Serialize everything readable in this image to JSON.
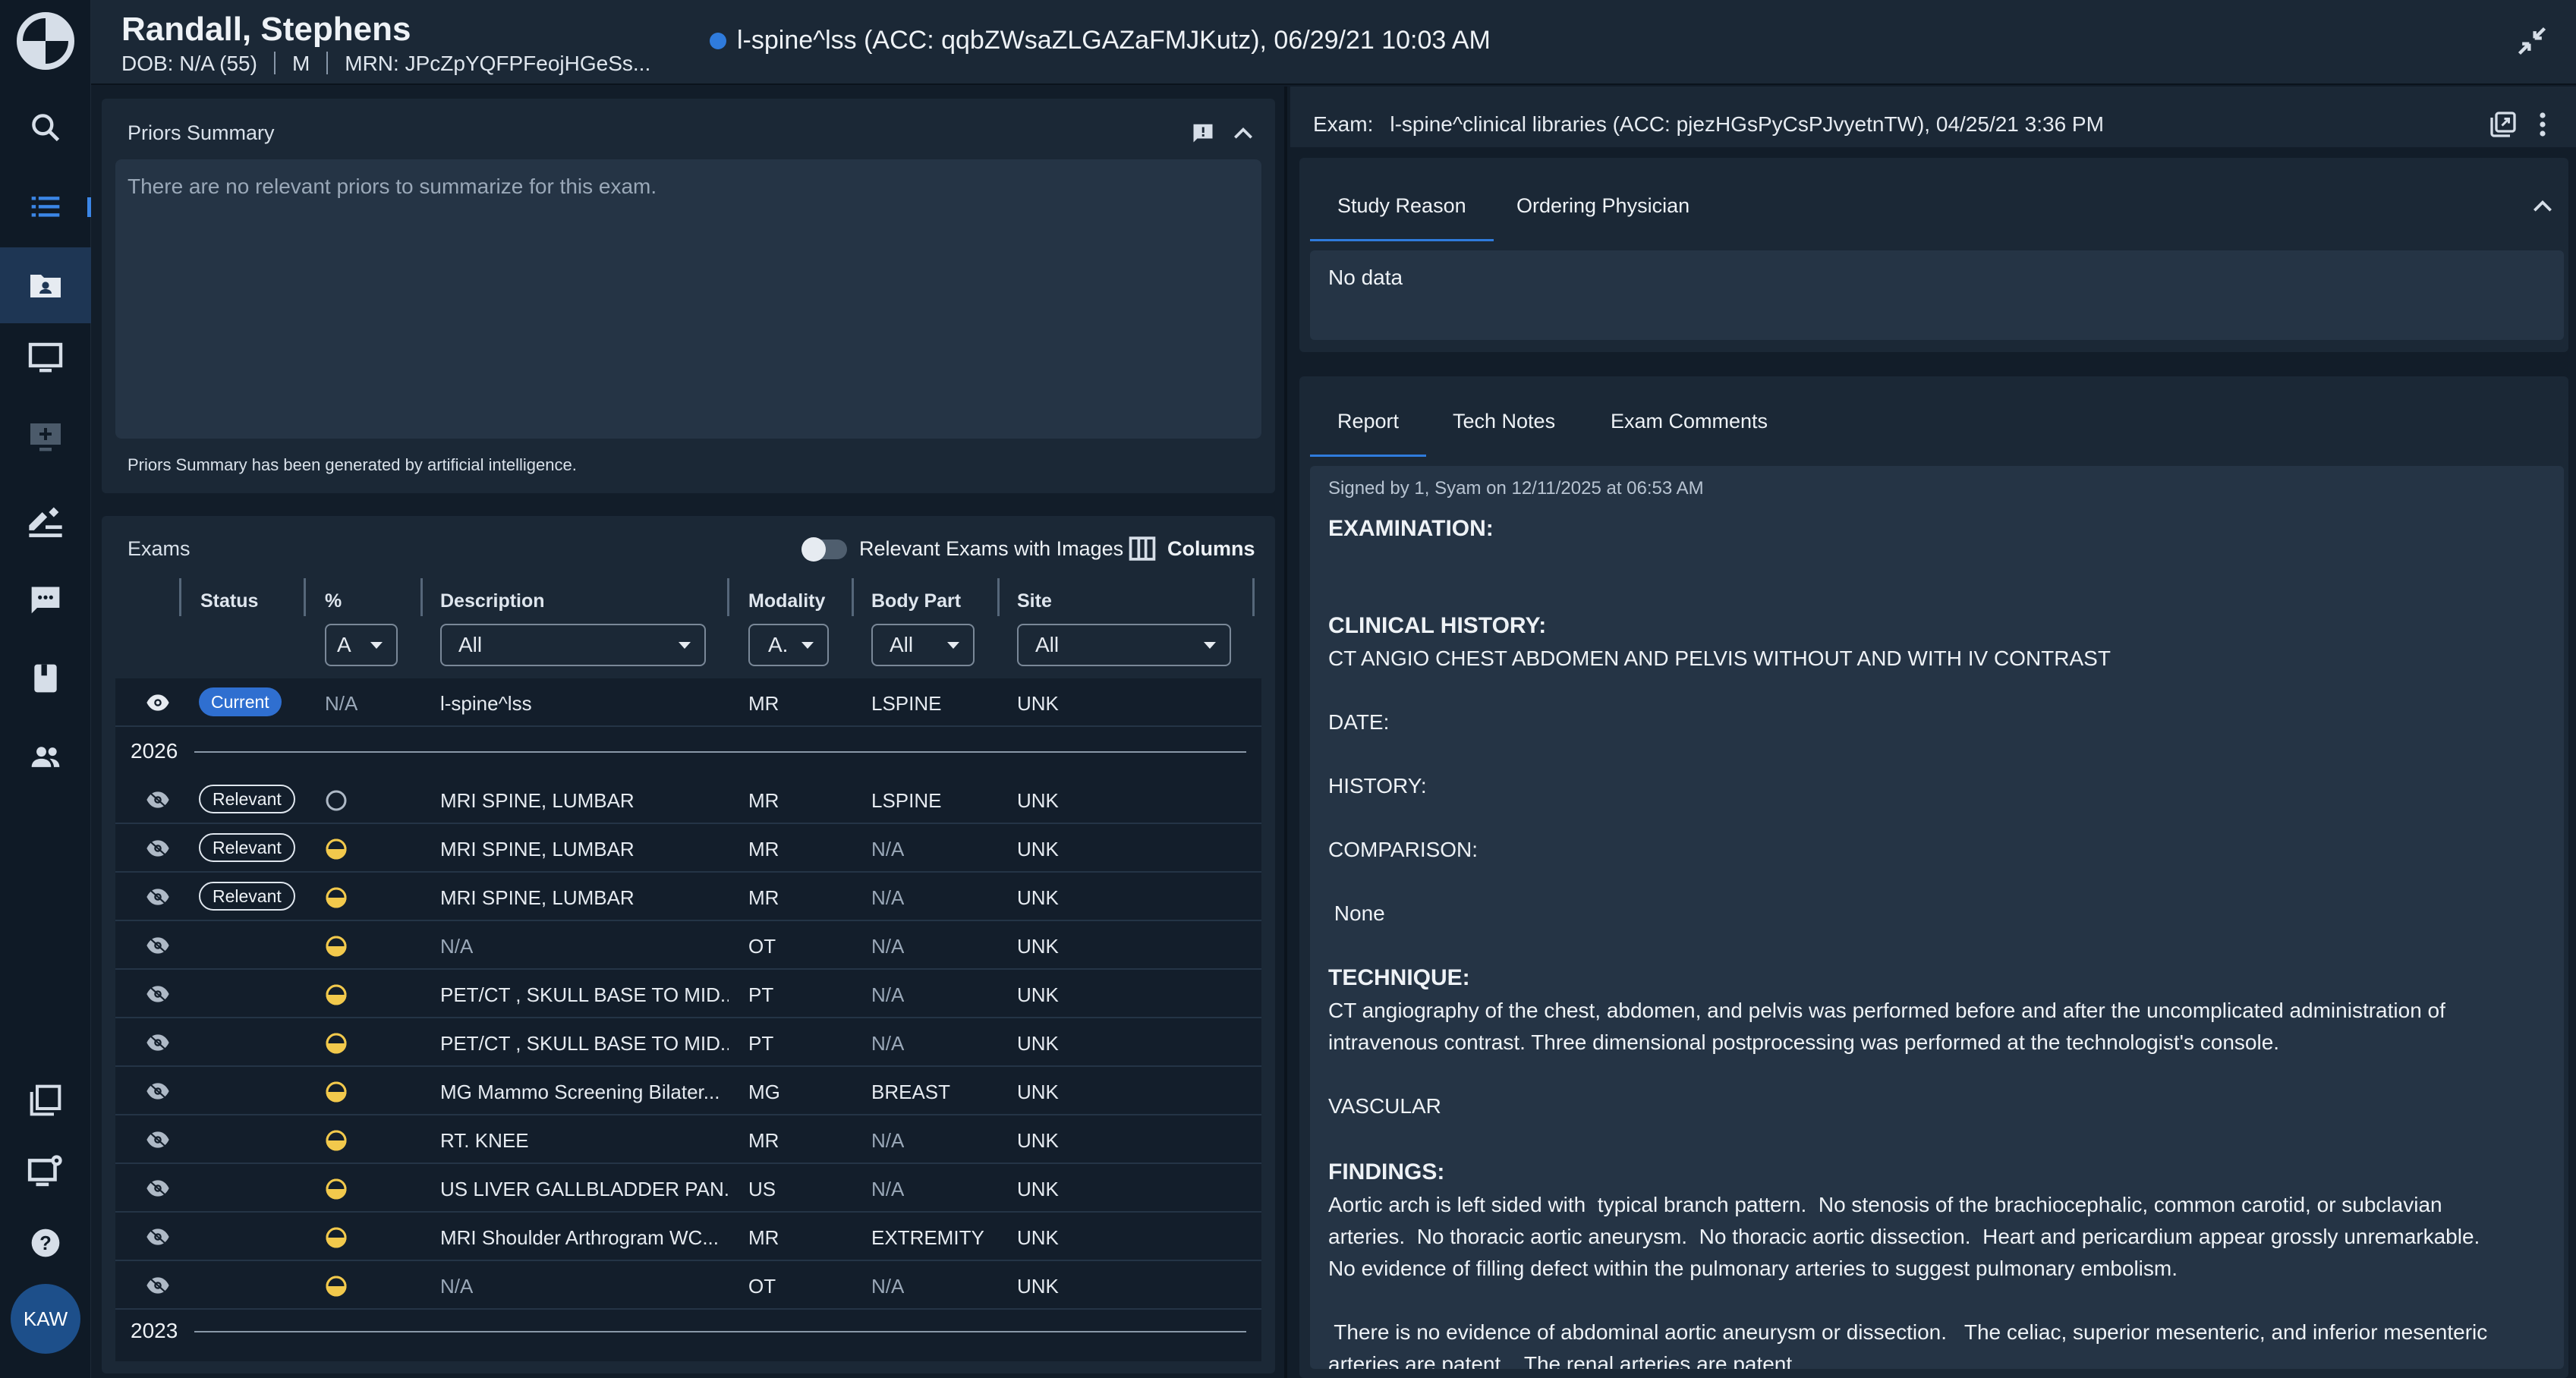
{
  "header": {
    "patient_name": "Randall, Stephens",
    "dob": "DOB: N/A (55)",
    "sex": "M",
    "mrn": "MRN: JPcZpYQFPFeojHGeSs...",
    "exam": "l-spine^lss (ACC: qqbZWsaZLGAZaFMJKutz), 06/29/21 10:03 AM"
  },
  "sidebar": {
    "avatar_initials": "KAW",
    "items": [
      "logo-icon",
      "search-icon",
      "worklist-icon",
      "patient-folder-icon",
      "monitor-icon",
      "monitor-add-icon",
      "edit-report-icon",
      "chat-icon",
      "book-icon",
      "people-icon",
      "layers-icon",
      "monitor-settings-icon",
      "help-icon"
    ]
  },
  "priors": {
    "title": "Priors Summary",
    "body": "There are no relevant priors to summarize for this exam.",
    "footnote": "Priors Summary has been generated by artificial intelligence."
  },
  "exams": {
    "title": "Exams",
    "toggle_label": "Relevant Exams with Images",
    "columns_label": "Columns",
    "headers": [
      "Status",
      "%",
      "Description",
      "Modality",
      "Body Part",
      "Site"
    ],
    "filters": {
      "percent": "A",
      "description": "All",
      "modality": "A.",
      "body_part": "All",
      "site": "All"
    },
    "current_row": {
      "status": "Current",
      "percent": "N/A",
      "description": "l-spine^lss",
      "modality": "MR",
      "body_part": "LSPINE",
      "site": "UNK"
    },
    "year_2026": "2026",
    "year_2023": "2023",
    "rows": [
      {
        "status": "Relevant",
        "progress": "empty",
        "description": "MRI SPINE, LUMBAR",
        "modality": "MR",
        "body_part": "LSPINE",
        "site": "UNK"
      },
      {
        "status": "Relevant",
        "progress": "half",
        "description": "MRI SPINE, LUMBAR",
        "modality": "MR",
        "body_part": "N/A",
        "site": "UNK"
      },
      {
        "status": "Relevant",
        "progress": "half",
        "description": "MRI SPINE, LUMBAR",
        "modality": "MR",
        "body_part": "N/A",
        "site": "UNK"
      },
      {
        "status": "",
        "progress": "half",
        "description": "N/A",
        "modality": "OT",
        "body_part": "N/A",
        "site": "UNK"
      },
      {
        "status": "",
        "progress": "half",
        "description": "PET/CT , SKULL BASE TO MID...",
        "modality": "PT",
        "body_part": "N/A",
        "site": "UNK"
      },
      {
        "status": "",
        "progress": "half",
        "description": "PET/CT , SKULL BASE TO MID...",
        "modality": "PT",
        "body_part": "N/A",
        "site": "UNK"
      },
      {
        "status": "",
        "progress": "half",
        "description": "MG Mammo Screening Bilater...",
        "modality": "MG",
        "body_part": "BREAST",
        "site": "UNK"
      },
      {
        "status": "",
        "progress": "half",
        "description": "RT. KNEE",
        "modality": "MR",
        "body_part": "N/A",
        "site": "UNK"
      },
      {
        "status": "",
        "progress": "half",
        "description": "US LIVER GALLBLADDER PAN...",
        "modality": "US",
        "body_part": "N/A",
        "site": "UNK"
      },
      {
        "status": "",
        "progress": "half",
        "description": "MRI Shoulder Arthrogram WC...",
        "modality": "MR",
        "body_part": "EXTREMITY",
        "site": "UNK"
      },
      {
        "status": "",
        "progress": "half",
        "description": "N/A",
        "modality": "OT",
        "body_part": "N/A",
        "site": "UNK"
      }
    ]
  },
  "right": {
    "exam_label": "Exam:",
    "exam_title": "l-spine^clinical libraries (ACC: pjezHGsPyCsPJvyetnTW), 04/25/21 3:36 PM",
    "top_tabs": [
      "Study Reason",
      "Ordering Physician"
    ],
    "no_data": "No data",
    "report_tabs": [
      "Report",
      "Tech Notes",
      "Exam Comments"
    ],
    "signed": "Signed by 1, Syam on 12/11/2025 at 06:53 AM",
    "report": {
      "examination": "EXAMINATION:",
      "clinical_history": "CLINICAL HISTORY:",
      "clinical_history_text": "CT ANGIO CHEST ABDOMEN AND PELVIS WITHOUT AND WITH IV CONTRAST",
      "date": "DATE:",
      "history": "HISTORY:",
      "comparison": "COMPARISON:",
      "comparison_text": " None",
      "technique": "TECHNIQUE:",
      "technique_1": "CT angiography of the chest, abdomen, and pelvis was performed before and after the uncomplicated administration of",
      "technique_2": "intravenous contrast. Three dimensional postprocessing was performed at the technologist's console.",
      "vascular": "VASCULAR",
      "findings": "FINDINGS:",
      "findings_1": "Aortic arch is left sided with  typical branch pattern.  No stenosis of the brachiocephalic, common carotid, or subclavian",
      "findings_2": "arteries.  No thoracic aortic aneurysm.  No thoracic aortic dissection.  Heart and pericardium appear grossly unremarkable.",
      "findings_3": "No evidence of filling defect within the pulmonary arteries to suggest pulmonary embolism.",
      "findings_4": " There is no evidence of abdominal aortic aneurysm or dissection.   The celiac, superior mesenteric, and inferior mesenteric",
      "findings_5": "arteries are patent.   The renal arteries are patent."
    }
  }
}
